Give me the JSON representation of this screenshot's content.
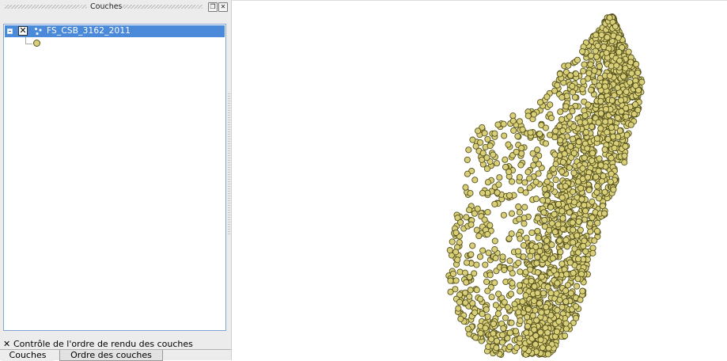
{
  "layers_panel": {
    "title": "Couches",
    "float_icon": "float-window-icon",
    "close_icon": "close-icon",
    "layers": [
      {
        "name": "FS_CSB_3162_2011",
        "visible": true,
        "visible_mark": "✕",
        "icon": "point-layer-icon",
        "symbol_color": "#d8cf78",
        "symbol_outline": "#55511e"
      }
    ],
    "render_order_checkbox": {
      "checked": true,
      "mark": "✕",
      "label": "Contrôle de l'ordre de rendu des couches"
    },
    "tabs": [
      "Couches",
      "Ordre des couches"
    ],
    "active_tab": "Couches"
  },
  "map": {
    "background": "#ffffff",
    "point_fill": "#d8cf78",
    "point_stroke": "#55511e"
  },
  "colors": {
    "selection": "#4a8ad8",
    "panel_bg": "#ececec"
  }
}
